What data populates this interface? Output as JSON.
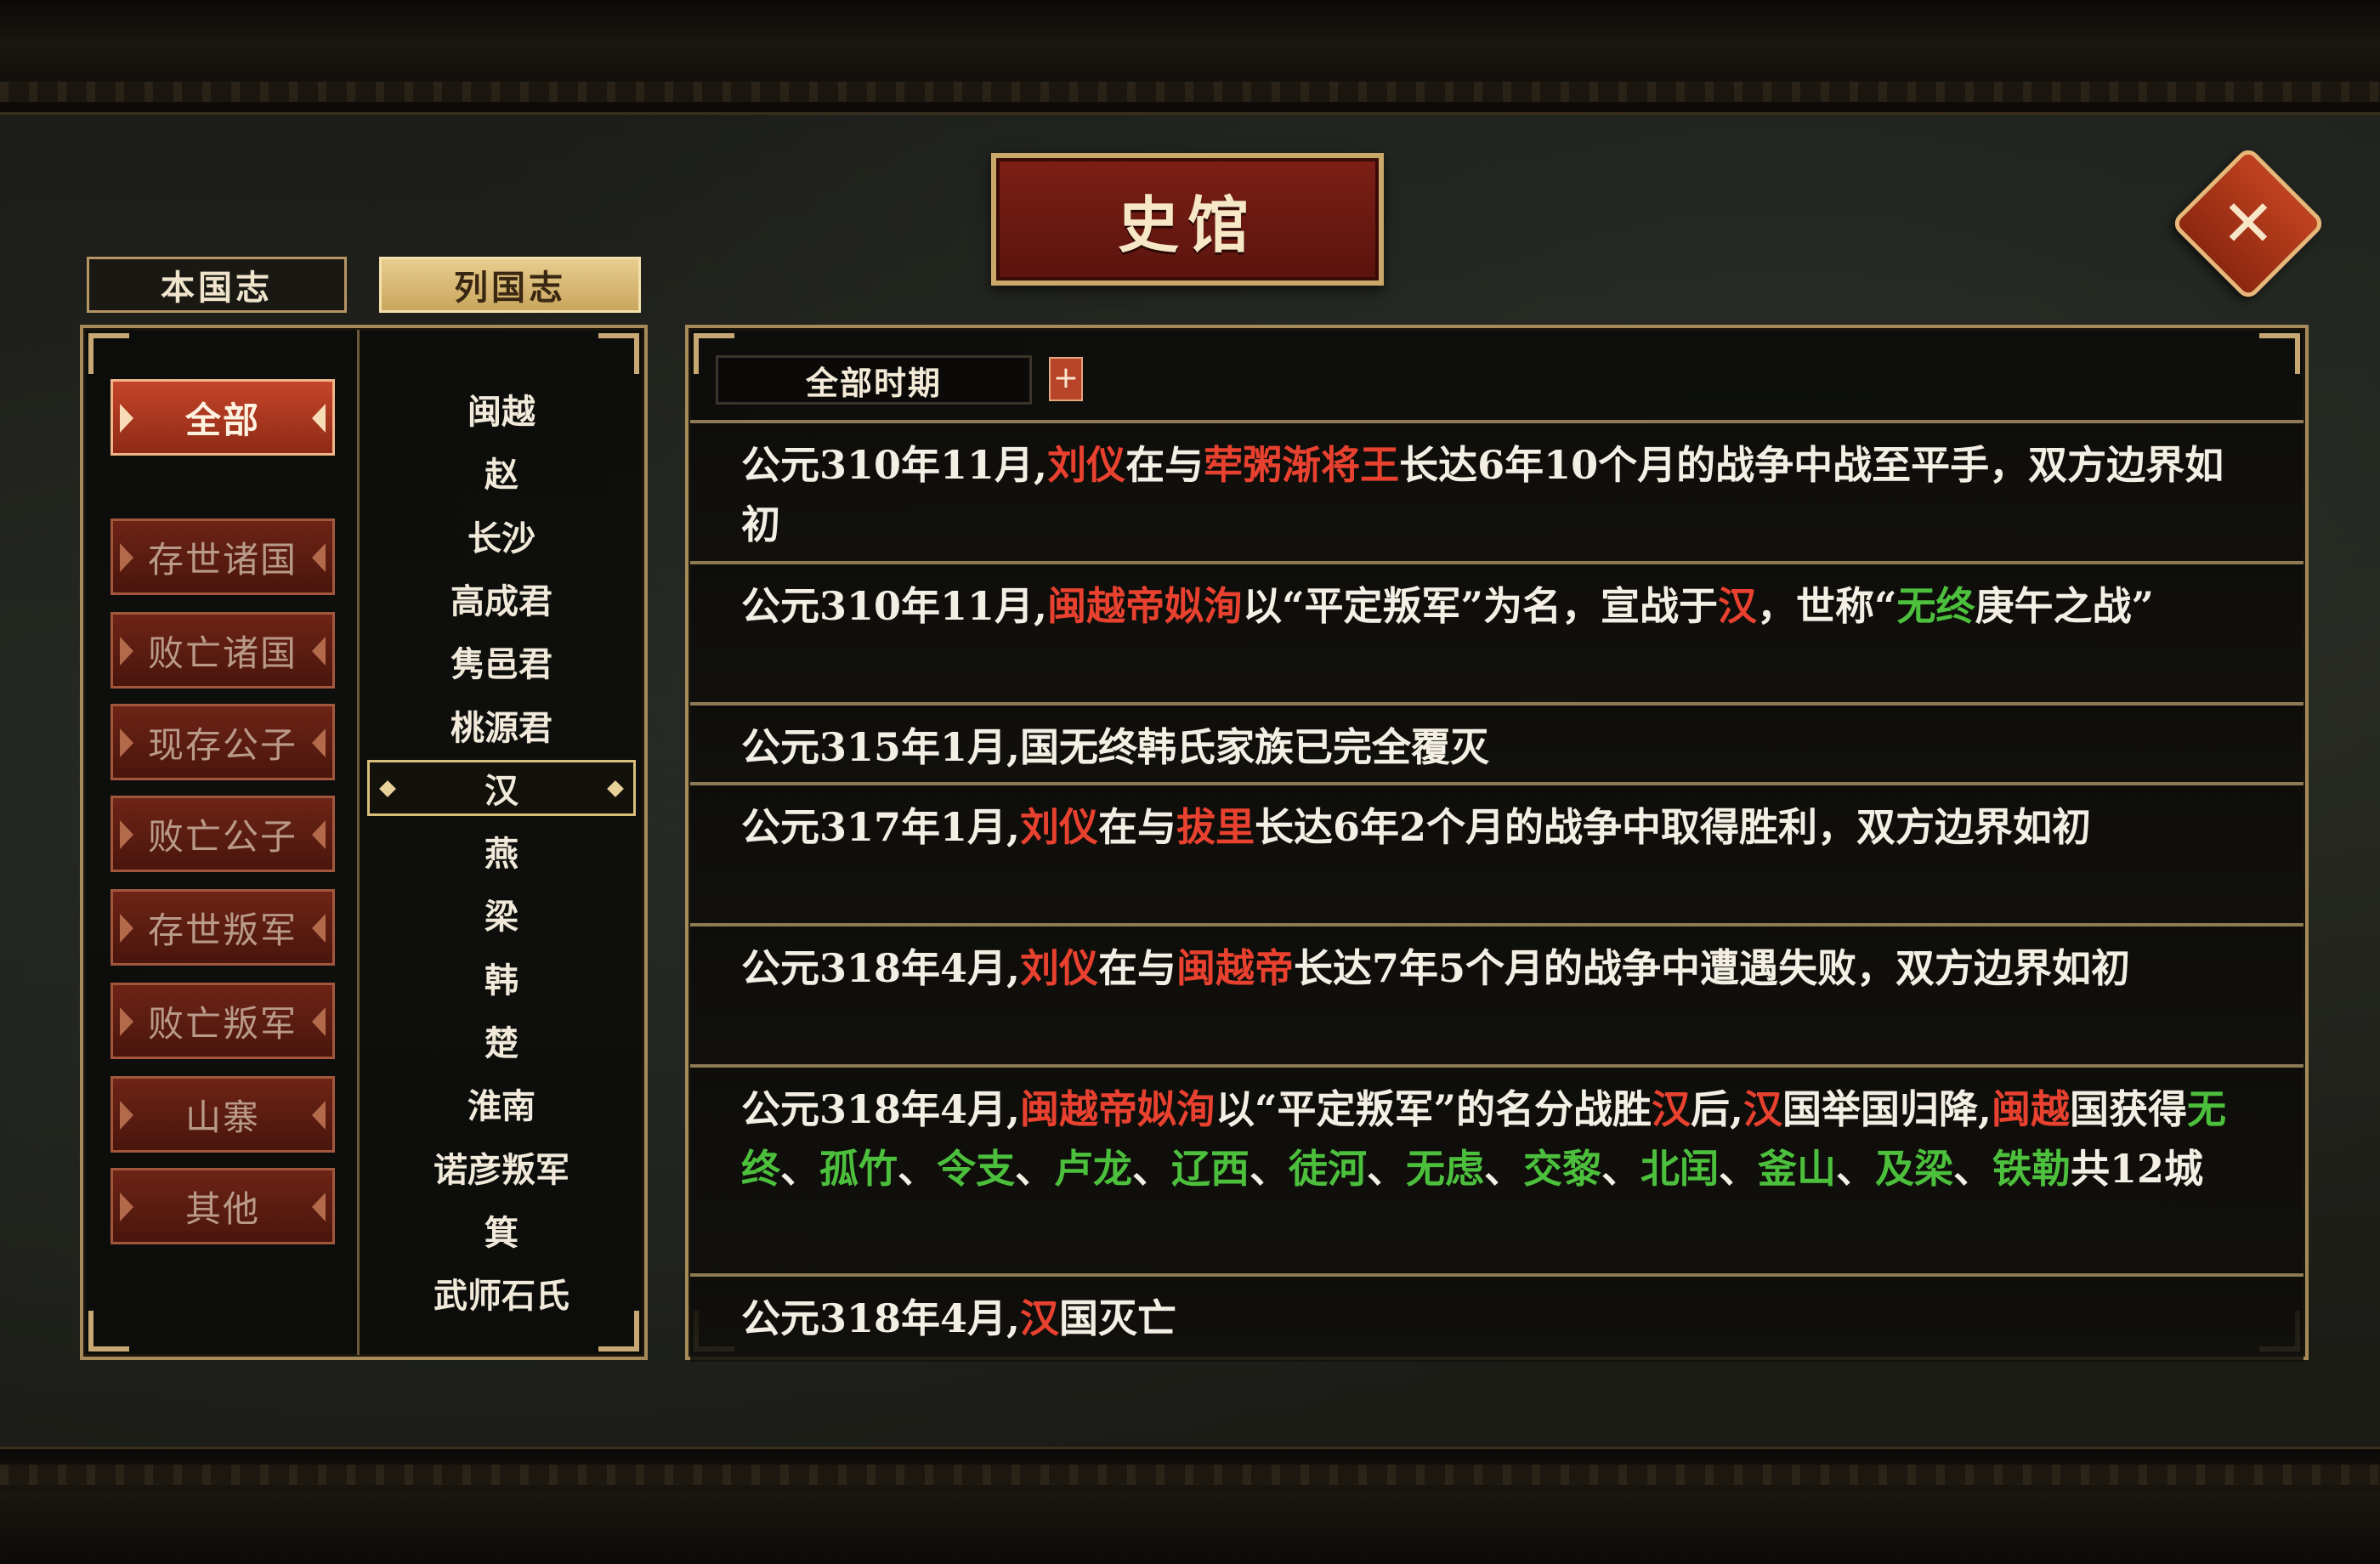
{
  "title": "史馆",
  "close_label": "✕",
  "top_tabs": [
    "本国志",
    "列国志"
  ],
  "categories": [
    {
      "label": "全部",
      "active": true
    },
    {
      "label": "存世诸国",
      "active": false
    },
    {
      "label": "败亡诸国",
      "active": false
    },
    {
      "label": "现存公子",
      "active": false
    },
    {
      "label": "败亡公子",
      "active": false
    },
    {
      "label": "存世叛军",
      "active": false
    },
    {
      "label": "败亡叛军",
      "active": false
    },
    {
      "label": "山寨",
      "active": false
    },
    {
      "label": "其他",
      "active": false
    }
  ],
  "states": [
    "闽越",
    "赵",
    "长沙",
    "高成君",
    "隽邑君",
    "桃源君",
    "汉",
    "燕",
    "梁",
    "韩",
    "楚",
    "淮南",
    "诺彦叛军",
    "箕",
    "武师石氏"
  ],
  "selected_state": "汉",
  "period_filter": "全部时期",
  "period_add": "+",
  "colors": {
    "red": "#e8412f",
    "green": "#4cc03c",
    "white": "#f4efe5",
    "gold": "#c9a86a"
  },
  "events": [
    {
      "segments": [
        {
          "t": "公元310年11月,",
          "c": "w"
        },
        {
          "t": "刘仪",
          "c": "r"
        },
        {
          "t": "在与",
          "c": "w"
        },
        {
          "t": "荦粥渐将王",
          "c": "r"
        },
        {
          "t": "长达6年10个月的战争中战至平手，双方边界如初",
          "c": "w"
        }
      ]
    },
    {
      "segments": [
        {
          "t": "公元310年11月,",
          "c": "w"
        },
        {
          "t": "闽越帝姒洵",
          "c": "r"
        },
        {
          "t": "以“平定叛军”为名，宣战于",
          "c": "w"
        },
        {
          "t": "汉",
          "c": "r"
        },
        {
          "t": "，世称“",
          "c": "w"
        },
        {
          "t": "无终",
          "c": "g"
        },
        {
          "t": "庚午之战”",
          "c": "w"
        }
      ]
    },
    {
      "segments": [
        {
          "t": "公元315年1月,国无终韩氏家族已完全覆灭",
          "c": "w"
        }
      ]
    },
    {
      "segments": [
        {
          "t": "公元317年1月,",
          "c": "w"
        },
        {
          "t": "刘仪",
          "c": "r"
        },
        {
          "t": "在与",
          "c": "w"
        },
        {
          "t": "拔里",
          "c": "r"
        },
        {
          "t": "长达6年2个月的战争中取得胜利，双方边界如初",
          "c": "w"
        }
      ]
    },
    {
      "segments": [
        {
          "t": "公元318年4月,",
          "c": "w"
        },
        {
          "t": "刘仪",
          "c": "r"
        },
        {
          "t": "在与",
          "c": "w"
        },
        {
          "t": "闽越帝",
          "c": "r"
        },
        {
          "t": "长达7年5个月的战争中遭遇失败，双方边界如初",
          "c": "w"
        }
      ]
    },
    {
      "segments": [
        {
          "t": "公元318年4月,",
          "c": "w"
        },
        {
          "t": "闽越帝姒洵",
          "c": "r"
        },
        {
          "t": "以“平定叛军”的名分战胜",
          "c": "w"
        },
        {
          "t": "汉",
          "c": "r"
        },
        {
          "t": "后,",
          "c": "w"
        },
        {
          "t": "汉",
          "c": "r"
        },
        {
          "t": "国举国归降,",
          "c": "w"
        },
        {
          "t": "闽越",
          "c": "r"
        },
        {
          "t": "国获得",
          "c": "w"
        },
        {
          "t": "无终",
          "c": "g"
        },
        {
          "t": "、",
          "c": "w"
        },
        {
          "t": "孤竹",
          "c": "g"
        },
        {
          "t": "、",
          "c": "w"
        },
        {
          "t": "令支",
          "c": "g"
        },
        {
          "t": "、",
          "c": "w"
        },
        {
          "t": "卢龙",
          "c": "g"
        },
        {
          "t": "、",
          "c": "w"
        },
        {
          "t": "辽西",
          "c": "g"
        },
        {
          "t": "、",
          "c": "w"
        },
        {
          "t": "徒河",
          "c": "g"
        },
        {
          "t": "、",
          "c": "w"
        },
        {
          "t": "无虑",
          "c": "g"
        },
        {
          "t": "、",
          "c": "w"
        },
        {
          "t": "交黎",
          "c": "g"
        },
        {
          "t": "、",
          "c": "w"
        },
        {
          "t": "北闰",
          "c": "g"
        },
        {
          "t": "、",
          "c": "w"
        },
        {
          "t": "釜山",
          "c": "g"
        },
        {
          "t": "、",
          "c": "w"
        },
        {
          "t": "及梁",
          "c": "g"
        },
        {
          "t": "、",
          "c": "w"
        },
        {
          "t": "铁勒",
          "c": "g"
        },
        {
          "t": "共12城",
          "c": "w"
        }
      ]
    },
    {
      "segments": [
        {
          "t": "公元318年4月,",
          "c": "w"
        },
        {
          "t": "汉",
          "c": "r"
        },
        {
          "t": "国灭亡",
          "c": "w"
        }
      ]
    }
  ]
}
